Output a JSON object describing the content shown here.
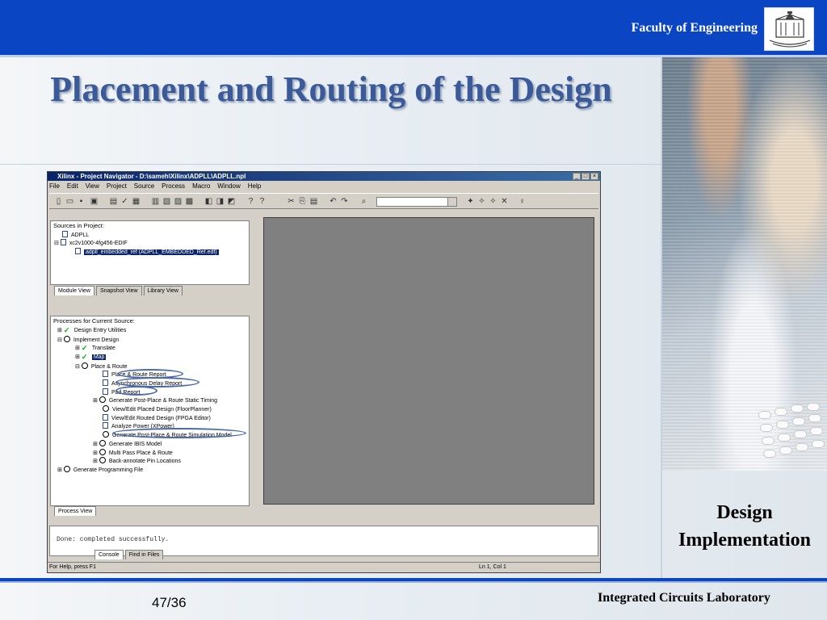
{
  "slide": {
    "faculty": "Faculty of Engineering",
    "title": "Placement and Routing of the Design",
    "side_label": "Design Implementation",
    "page": "47/36",
    "lab": "Integrated Circuits Laboratory",
    "colors": {
      "header_blue": "#0a45c4",
      "title_color": "#3a5a9a"
    }
  },
  "window": {
    "title": "Xilinx - Project Navigator - D:\\sameh\\Xilinx\\ADPLL\\ADPLL.npl",
    "menu": [
      "File",
      "Edit",
      "View",
      "Project",
      "Source",
      "Process",
      "Macro",
      "Window",
      "Help"
    ],
    "sources_header": "Sources in Project:",
    "sources": [
      {
        "label": "ADPLL",
        "icon": "chip-icon"
      },
      {
        "label": "xc2v1000-4fg456-EDIF",
        "icon": "device-icon"
      },
      {
        "label": "adpll_embedded_ref (ADPLL_EMBEDDED_Ref.edf)",
        "icon": "file-icon",
        "selected": true
      }
    ],
    "source_tabs": [
      "Module View",
      "Snapshot View",
      "Library View"
    ],
    "processes_header": "Processes for Current Source:",
    "processes": [
      {
        "label": "Design Entry Utilities",
        "indent": 0
      },
      {
        "label": "Implement Design",
        "indent": 0
      },
      {
        "label": "Translate",
        "indent": 1
      },
      {
        "label": "Map",
        "indent": 1
      },
      {
        "label": "Place & Route",
        "indent": 1
      },
      {
        "label": "Place & Route Report",
        "indent": 2
      },
      {
        "label": "Asynchronous Delay Report",
        "indent": 2
      },
      {
        "label": "Pad Report",
        "indent": 2
      },
      {
        "label": "Generate Post-Place & Route Static Timing",
        "indent": 2
      },
      {
        "label": "View/Edit Placed Design (FloorPlanner)",
        "indent": 2
      },
      {
        "label": "View/Edit Routed Design (FPGA Editor)",
        "indent": 2
      },
      {
        "label": "Analyze Power (XPower)",
        "indent": 2
      },
      {
        "label": "Generate Post-Place & Route Simulation Model",
        "indent": 2
      },
      {
        "label": "Generate IBIS Model",
        "indent": 2
      },
      {
        "label": "Multi Pass Place & Route",
        "indent": 2
      },
      {
        "label": "Back-annotate Pin Locations",
        "indent": 2
      },
      {
        "label": "Generate Programming File",
        "indent": 0
      }
    ],
    "process_tab": "Process View",
    "console_text": "Done: completed successfully.",
    "console_tabs": [
      "Console",
      "Find in Files"
    ],
    "status_left": "For Help, press F1",
    "status_pos": "Ln 1, Col 1"
  }
}
